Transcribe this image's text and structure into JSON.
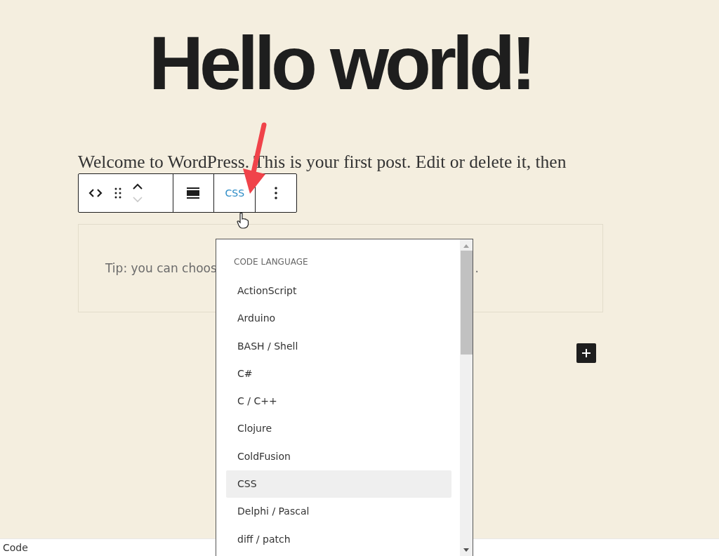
{
  "post": {
    "title": "Hello world!",
    "paragraph": "Welcome to WordPress. This is your first post. Edit or delete it, then"
  },
  "toolbar": {
    "language_button": "CSS",
    "move_down_disabled": true
  },
  "code_block": {
    "tip": "Tip: you can choos",
    "tip_end": "."
  },
  "language_menu": {
    "heading": "CODE LANGUAGE",
    "items": [
      {
        "label": "ActionScript",
        "selected": false
      },
      {
        "label": "Arduino",
        "selected": false
      },
      {
        "label": "BASH / Shell",
        "selected": false
      },
      {
        "label": "C#",
        "selected": false
      },
      {
        "label": "C / C++",
        "selected": false
      },
      {
        "label": "Clojure",
        "selected": false
      },
      {
        "label": "ColdFusion",
        "selected": false
      },
      {
        "label": "CSS",
        "selected": true
      },
      {
        "label": "Delphi / Pascal",
        "selected": false
      },
      {
        "label": "diff / patch",
        "selected": false
      }
    ]
  },
  "status_bar": {
    "text": "Code"
  }
}
